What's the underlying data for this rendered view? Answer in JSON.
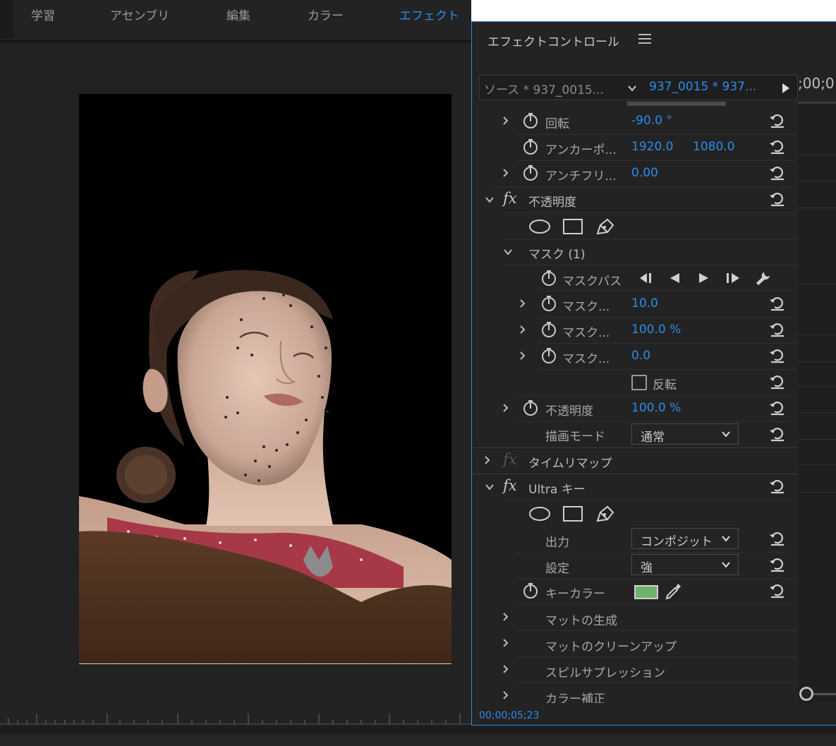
{
  "workspace_tabs": [
    {
      "label": "学習"
    },
    {
      "label": "アセンブリ"
    },
    {
      "label": "編集"
    },
    {
      "label": "カラー"
    },
    {
      "label": "エフェクト",
      "active": true
    }
  ],
  "effect_controls": {
    "title": "エフェクトコントロール",
    "source_label": "ソース * 937_0015...",
    "sequence_label": "937_0015 * 937...",
    "timecode_top": ";00;0",
    "timecode_bottom": "00;00;05;23",
    "rows": {
      "rotation": {
        "label": "回転",
        "value": "-90.0 °"
      },
      "anchor": {
        "label": "アンカーポ...",
        "value_x": "1920.0",
        "value_y": "1080.0"
      },
      "antiflicker": {
        "label": "アンチフリ...",
        "value": "0.00"
      },
      "opacity_section": {
        "label": "不透明度"
      },
      "mask_header": {
        "label": "マスク (1)"
      },
      "mask_path": {
        "label": "マスクパス"
      },
      "mask_feather": {
        "label": "マスク...",
        "value": "10.0"
      },
      "mask_opacity": {
        "label": "マスク...",
        "value": "100.0 %"
      },
      "mask_expansion": {
        "label": "マスク...",
        "value": "0.0"
      },
      "invert": {
        "label": "反転"
      },
      "opacity": {
        "label": "不透明度",
        "value": "100.0 %"
      },
      "blend_mode": {
        "label": "描画モード",
        "value": "通常"
      },
      "time_remap": {
        "label": "タイムリマップ"
      },
      "ultra_key": {
        "label": "Ultra キー"
      },
      "output": {
        "label": "出力",
        "value": "コンポジット"
      },
      "setting": {
        "label": "設定",
        "value": "強"
      },
      "key_color": {
        "label": "キーカラー",
        "color": "#6fb36a"
      },
      "matte_generation": {
        "label": "マットの生成"
      },
      "matte_cleanup": {
        "label": "マットのクリーンアップ"
      },
      "spill_suppression": {
        "label": "スピルサプレッション"
      },
      "color_correction": {
        "label": "カラー補正"
      }
    }
  },
  "colors": {
    "accent": "#2d8ceb",
    "panel_bg": "#232323"
  }
}
